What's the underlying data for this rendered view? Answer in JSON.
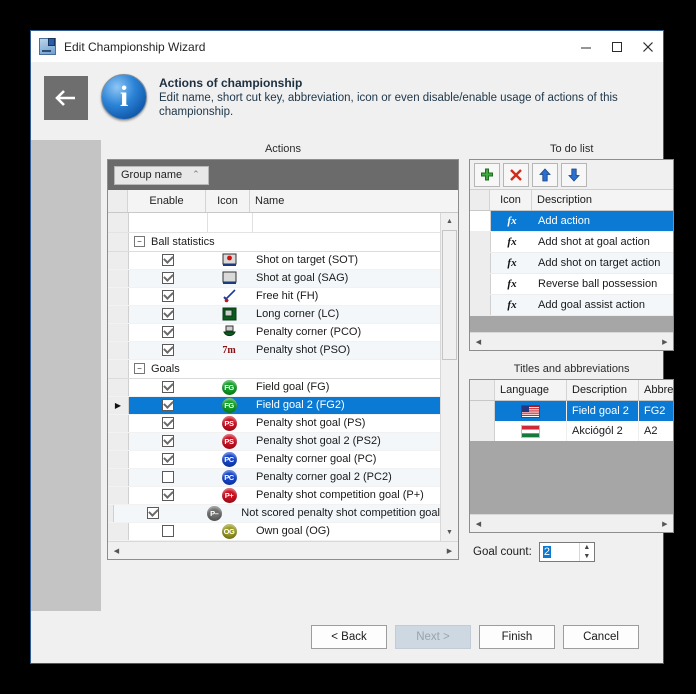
{
  "window": {
    "title": "Edit Championship Wizard",
    "minimize_label": "minimize",
    "maximize_label": "maximize",
    "close_label": "close"
  },
  "header": {
    "back_label": "Back",
    "info_glyph": "i",
    "title": "Actions of championship",
    "subtitle": "Edit name, short cut key, abbreviation, icon or even disable/enable usage of actions of this championship."
  },
  "actions_panel": {
    "caption": "Actions",
    "group_chip": "Group name",
    "group_sort_glyph": "⌃",
    "columns": [
      "",
      "Enable",
      "Icon",
      "Name"
    ],
    "groups": [
      {
        "name": "Ball statistics",
        "expander": "−",
        "rows": [
          {
            "enabled": true,
            "icon": "shot-on-target-icon",
            "name": "Shot on target (SOT)"
          },
          {
            "enabled": true,
            "icon": "shot-at-goal-icon",
            "name": "Shot at goal (SAG)"
          },
          {
            "enabled": true,
            "icon": "free-hit-icon",
            "name": "Free hit (FH)"
          },
          {
            "enabled": true,
            "icon": "long-corner-icon",
            "name": "Long corner (LC)"
          },
          {
            "enabled": true,
            "icon": "penalty-corner-icon",
            "name": "Penalty corner (PCO)"
          },
          {
            "enabled": true,
            "icon": "penalty-shot-icon",
            "name": "Penalty shot (PSO)",
            "icon_text": "7m"
          }
        ]
      },
      {
        "name": "Goals",
        "expander": "−",
        "rows": [
          {
            "enabled": true,
            "icon": "field-goal-icon",
            "icon_text": "FG",
            "name": "Field goal (FG)"
          },
          {
            "enabled": true,
            "icon": "field-goal-2-icon",
            "icon_text": "FG",
            "name": "Field goal 2 (FG2)",
            "selected": true
          },
          {
            "enabled": true,
            "icon": "penalty-shot-goal-icon",
            "icon_text": "PS",
            "name": "Penalty shot goal (PS)"
          },
          {
            "enabled": true,
            "icon": "penalty-shot-goal-2-icon",
            "icon_text": "PS",
            "name": "Penalty shot goal 2 (PS2)"
          },
          {
            "enabled": true,
            "icon": "penalty-corner-goal-icon",
            "icon_text": "PC",
            "name": "Penalty corner goal (PC)"
          },
          {
            "enabled": false,
            "icon": "penalty-corner-goal-2-icon",
            "icon_text": "PC",
            "name": "Penalty corner goal 2 (PC2)"
          },
          {
            "enabled": true,
            "icon": "penalty-shot-competition-goal-icon",
            "icon_text": "P+",
            "name": "Penalty shot competition goal (P+)"
          },
          {
            "enabled": true,
            "icon": "not-scored-penalty-icon",
            "icon_text": "P–",
            "name": "Not scored penalty shot competition goal"
          },
          {
            "enabled": false,
            "icon": "own-goal-icon",
            "icon_text": "OG",
            "name": "Own goal (OG)"
          }
        ]
      }
    ]
  },
  "todo_panel": {
    "caption": "To do list",
    "toolbar": {
      "add_label": "Add",
      "delete_label": "Delete",
      "up_label": "Move up",
      "down_label": "Move down"
    },
    "columns": [
      "",
      "Icon",
      "Description"
    ],
    "rows": [
      {
        "icon": "fx",
        "description": "Add action",
        "selected": true
      },
      {
        "icon": "fx",
        "description": "Add shot at goal action"
      },
      {
        "icon": "fx",
        "description": "Add shot on target action"
      },
      {
        "icon": "fx",
        "description": "Reverse ball possession"
      },
      {
        "icon": "fx",
        "description": "Add goal assist action"
      }
    ]
  },
  "titles_panel": {
    "caption": "Titles and abbreviations",
    "columns": [
      "",
      "Language",
      "Description",
      "Abbre"
    ],
    "rows": [
      {
        "language": "us-flag-icon",
        "description": "Field goal 2",
        "abbreviation": "FG2",
        "selected": true
      },
      {
        "language": "hu-flag-icon",
        "description": "Akciógól 2",
        "abbreviation": "A2"
      }
    ],
    "goal_count_label": "Goal count:",
    "goal_count_value": "2"
  },
  "footer": {
    "back": "< Back",
    "next": "Next >",
    "finish": "Finish",
    "cancel": "Cancel"
  },
  "colors": {
    "accent": "#0a7ad4",
    "titlebar_border": "#2f5d96",
    "band": "#6b6b6b",
    "sidebar": "#c4c4c4"
  }
}
